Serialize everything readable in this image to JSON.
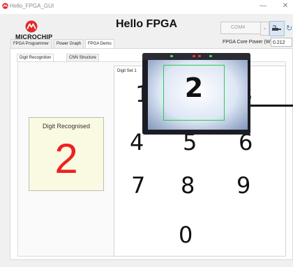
{
  "window": {
    "title": "Hello_FPGA_GUI",
    "minimize_glyph": "—",
    "close_glyph": "✕"
  },
  "header": {
    "logo_text": "MICROCHIP",
    "title": "Hello FPGA",
    "com_port": "COM4",
    "power_label": "FPGA Core Power (W)",
    "power_value": "0.212"
  },
  "main_tabs": [
    "FPGA Programmer",
    "Power Graph",
    "FPGA Demo"
  ],
  "active_main_tab": "FPGA Demo",
  "sub_tabs": [
    "Digit Recognition",
    "CNN Structure"
  ],
  "active_sub_tab": "Digit Recognition",
  "recognition": {
    "label": "Digit Recognised",
    "digit": "2"
  },
  "digit_set": {
    "title": "Digit Set 1",
    "digits": [
      "1",
      "2",
      "3",
      "4",
      "5",
      "6",
      "7",
      "8",
      "9",
      "0"
    ]
  },
  "camera": {
    "displayed_digit": "2"
  },
  "colors": {
    "recognised_digit": "#ee2121",
    "card_background": "#fafae2",
    "detection_box": "#24d04b"
  },
  "icons": [
    "app-icon",
    "microchip-logo-icon",
    "usb-connect-icon",
    "refresh-icon",
    "chevron-down-icon"
  ]
}
